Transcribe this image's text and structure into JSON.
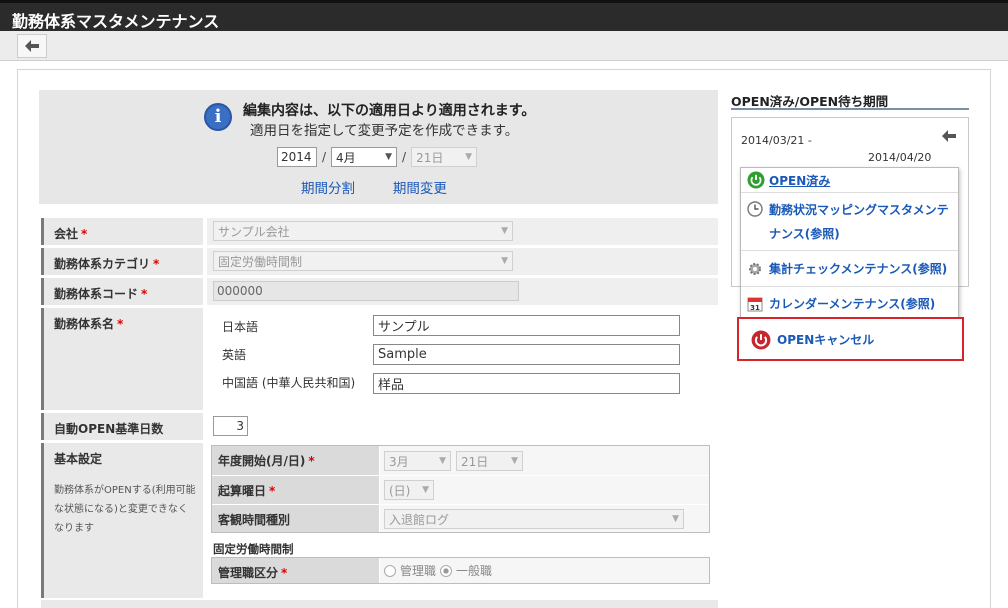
{
  "window": {
    "title": "勤務体系マスタメンテナンス"
  },
  "toolbar": {
    "back_icon": "back-arrow-icon"
  },
  "notice": {
    "line1": "編集内容は、以下の適用日より適用されます。",
    "line2": "適用日を指定して変更予定を作成できます。",
    "year": "2014",
    "month": "4月",
    "day": "21日",
    "slash": "/",
    "link_split": "期間分割",
    "link_change": "期間変更"
  },
  "form": {
    "company": {
      "label": "会社",
      "required": "*",
      "value": "サンプル会社"
    },
    "category": {
      "label": "勤務体系カテゴリ",
      "required": "*",
      "value": "固定労働時間制"
    },
    "code": {
      "label": "勤務体系コード",
      "required": "*",
      "value": "000000"
    },
    "name": {
      "label": "勤務体系名",
      "required": "*",
      "langs": [
        {
          "label": "日本語",
          "value": "サンプル"
        },
        {
          "label": "英語",
          "value": "Sample"
        },
        {
          "label": "中国語 (中華人民共和国)",
          "value": "样品"
        }
      ]
    },
    "auto_open": {
      "label": "自動OPEN基準日数",
      "value": "3"
    },
    "basic": {
      "label": "基本設定",
      "note": "勤務体系がOPENする(利用可能な状態になる)と変更できなくなります",
      "fiscal_start": {
        "label": "年度開始(月/日)",
        "required": "*",
        "month": "3月",
        "day": "21日"
      },
      "start_weekday": {
        "label": "起算曜日",
        "required": "*",
        "value": "(日)"
      },
      "objective_time": {
        "label": "客観時間種別",
        "value": "入退館ログ"
      },
      "section_title": "固定労働時間制",
      "manager": {
        "label": "管理職区分",
        "required": "*",
        "opt1": "管理職",
        "opt2": "一般職"
      }
    }
  },
  "side": {
    "title": "OPEN済み/OPEN待ち期間",
    "from": "2014/03/21  -",
    "to": "2014/04/20",
    "menu": [
      {
        "label": "OPEN済み",
        "icon": "power-green-icon"
      },
      {
        "label": "勤務状況マッピングマスタメンテナンス(参照)",
        "icon": "clock-icon"
      },
      {
        "label": "集計チェックメンテナンス(参照)",
        "icon": "gear-icon"
      },
      {
        "label": "カレンダーメンテナンス(参照)",
        "icon": "calendar-icon"
      }
    ],
    "cancel": {
      "label": "OPENキャンセル",
      "icon": "power-red-icon"
    }
  },
  "colors": {
    "accent": "#1a59b8",
    "highlight": "#d9232b",
    "titlebar": "#2b2b2b"
  }
}
